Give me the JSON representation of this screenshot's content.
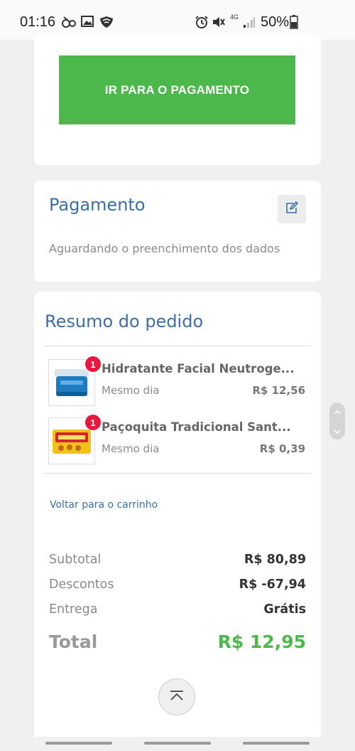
{
  "status_bar": {
    "time": "01:16",
    "network": "4G",
    "battery": "50%",
    "icons": [
      "voicemail-icon",
      "image-icon",
      "shield-wifi-icon",
      "alarm-icon",
      "mute-icon",
      "signal-icon",
      "battery-icon"
    ]
  },
  "payment_button": {
    "label": "IR PARA O PAGAMENTO",
    "color": "#4cb84c"
  },
  "payment_section": {
    "title": "Pagamento",
    "status": "Aguardando o preenchimento dos dados",
    "edit_icon": "edit-icon"
  },
  "summary": {
    "title": "Resumo do pedido",
    "items": [
      {
        "quantity": "1",
        "name": "Hidratante Facial Neutroge...",
        "delivery": "Mesmo dia",
        "price": "R$ 12,56"
      },
      {
        "quantity": "1",
        "name": "Paçoquita Tradicional Sant...",
        "delivery": "Mesmo dia",
        "price": "R$ 0,39"
      }
    ],
    "back_link": "Voltar para o carrinho",
    "subtotal_label": "Subtotal",
    "subtotal_value": "R$ 80,89",
    "discount_label": "Descontos",
    "discount_value": "R$ -67,94",
    "delivery_label": "Entrega",
    "delivery_value": "Grátis",
    "total_label": "Total",
    "total_value": "R$ 12,95"
  },
  "colors": {
    "accent": "#3b6ea5",
    "success": "#4cb84c",
    "badge": "#e8173e"
  }
}
